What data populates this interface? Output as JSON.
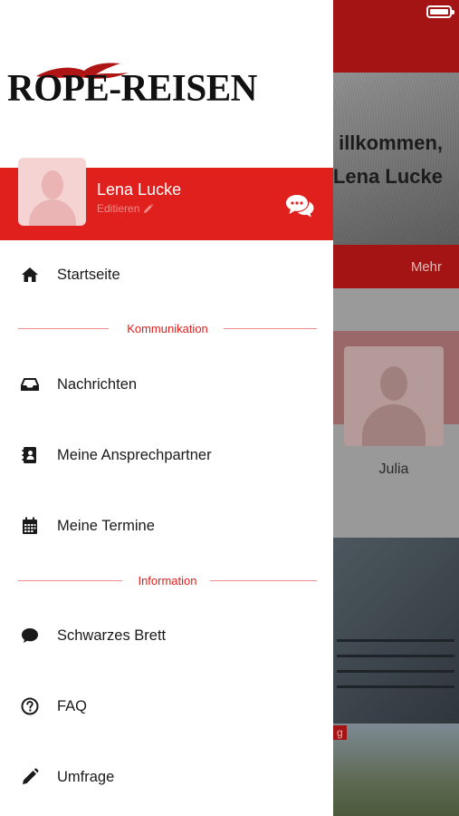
{
  "colors": {
    "brand_red": "#e0201d",
    "dark_red": "#a51414",
    "text": "#1a1a1a",
    "section": "#e0201d"
  },
  "background": {
    "welcome_line1": "illkommen,",
    "welcome_line2": "Lena Lucke",
    "more_label": "Mehr",
    "contact_name": "Julia",
    "tag_label": "g"
  },
  "drawer": {
    "logo_text": "ROPE-REISEN",
    "profile": {
      "name": "Lena Lucke",
      "edit_label": "Editieren"
    },
    "menu": {
      "home": {
        "label": "Startseite",
        "icon": "home-icon"
      },
      "section_communication": "Kommunikation",
      "messages": {
        "label": "Nachrichten",
        "icon": "inbox-icon"
      },
      "contacts": {
        "label": "Meine Ansprechpartner",
        "icon": "address-book-icon"
      },
      "appointments": {
        "label": "Meine Termine",
        "icon": "calendar-icon"
      },
      "section_information": "Information",
      "board": {
        "label": "Schwarzes Brett",
        "icon": "speech-bubble-icon"
      },
      "faq": {
        "label": "FAQ",
        "icon": "question-circle-icon"
      },
      "survey": {
        "label": "Umfrage",
        "icon": "pencil-icon"
      }
    }
  }
}
